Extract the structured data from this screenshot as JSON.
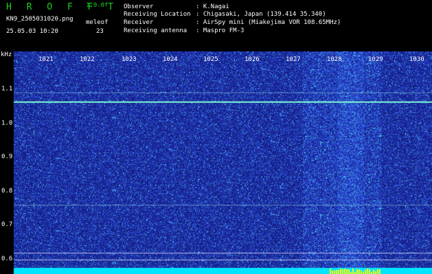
{
  "header": {
    "app_title": "H R O F F T",
    "version": "1.0.0f",
    "filename": "KN9_2505031020.png",
    "datetime": "25.05.03 10:20",
    "mode_label": "meleof",
    "mode_value": "23",
    "info": [
      {
        "label": "Observer",
        "value": ": K.Nagai"
      },
      {
        "label": "Receiving Location",
        "value": ": Chigasaki, Japan (139.414 35.340)"
      },
      {
        "label": "Receiver",
        "value": ": AirSpy mini (Miakejima VOR 108.65MHz)"
      },
      {
        "label": "Receiving antenna",
        "value": ": Maspro FM-3"
      }
    ]
  },
  "spectrogram": {
    "y_unit": "kHz",
    "y_ticks": [
      "1.1",
      "1.0",
      "0.9",
      "0.8",
      "0.7",
      "0.6"
    ],
    "x_ticks": [
      "1021",
      "1022",
      "1023",
      "1024",
      "1025",
      "1026",
      "1027",
      "1028",
      "1029",
      "1030"
    ],
    "colors": {
      "background": "#16208a",
      "noise_low": "#2e4fd6",
      "noise_high": "#3fd3e8",
      "line": "#7fffd4",
      "floor": "#00e5ff",
      "floor_peak": "#ffff00"
    }
  }
}
